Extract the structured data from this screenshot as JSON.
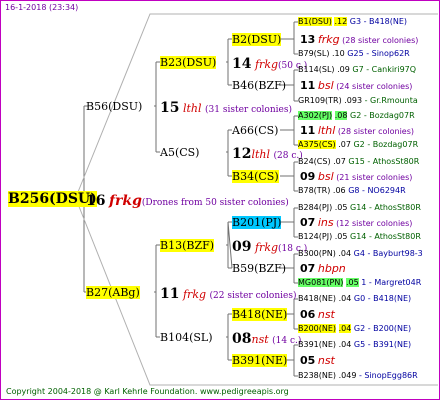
{
  "header": "16-1-2018 (23:34)",
  "footer": "Copyright 2004-2018 @ Karl Kehrle Foundation.   www.pedigreeapis.org",
  "root": {
    "id": "B256(DSU)",
    "num": "16",
    "race": "frkg",
    "note": "(Drones from 50 sister colonies)"
  },
  "gen1": [
    {
      "id": "B56(DSU)",
      "num": "15",
      "race": "lthl",
      "note": "(31 sister colonies)"
    },
    {
      "id": "B27(ABg)",
      "num": "11",
      "race": "frkg",
      "note": "(22 sister colonies)"
    }
  ],
  "gen2": [
    {
      "id": "B23(DSU)",
      "num": "14",
      "race": "frkg",
      "note": "(50 c.)"
    },
    {
      "id": "A5(CS)",
      "num": "12",
      "race": "lthl",
      "note": "(28 c.)"
    },
    {
      "id": "B13(BZF)",
      "num": "09",
      "race": "frkg",
      "note": "(18 c.)"
    },
    {
      "id": "B104(SL)",
      "num": "08",
      "race": "nst",
      "note": "(14 c.)"
    }
  ],
  "gen3": [
    {
      "id": "B2(DSU)",
      "num": "13",
      "race": "frkg",
      "note": "(28 sister colonies)"
    },
    {
      "id": "B46(BZF)",
      "num": "11",
      "race": "bsl",
      "note": "(24 sister colonies)"
    },
    {
      "id": "A66(CS)",
      "num": "11",
      "race": "lthl",
      "note": "(28 sister colonies)"
    },
    {
      "id": "B34(CS)",
      "num": "09",
      "race": "bsl",
      "note": "(21 sister colonies)"
    },
    {
      "id": "B201(PJ)",
      "num": "07",
      "race": "ins",
      "note": "(12 sister colonies)"
    },
    {
      "id": "B59(BZF)",
      "num": "07",
      "race": "hbpn",
      "note": ""
    },
    {
      "id": "B418(NE)",
      "num": "06",
      "race": "nst",
      "note": ""
    },
    {
      "id": "B391(NE)",
      "num": "05",
      "race": "nst",
      "note": ""
    }
  ],
  "gen4": [
    {
      "id": "B1(DSU)",
      "val": ".12",
      "ref": "G3 - B418(NE)"
    },
    {
      "id": "B79(SL)",
      "val": ".10",
      "ref": "G25 - Sinop62R"
    },
    {
      "id": "B114(SL)",
      "val": ".09",
      "ref": "G7 - Cankiri97Q"
    },
    {
      "id": "GR109(TR)",
      "val": ".093",
      "ref": "- Gr.Rmounta"
    },
    {
      "id": "A302(PJ)",
      "val": ".08",
      "ref": "G2 - Bozdag07R"
    },
    {
      "id": "A375(CS)",
      "val": ".07",
      "ref": "G2 - Bozdag07R"
    },
    {
      "id": "B24(CS)",
      "val": ".07",
      "ref": "G15 - AthosSt80R"
    },
    {
      "id": "B78(TR)",
      "val": ".06",
      "ref": "G8 - NO6294R"
    },
    {
      "id": "B284(PJ)",
      "val": ".05",
      "ref": "G14 - AthosSt80R"
    },
    {
      "id": "B124(PJ)",
      "val": ".05",
      "ref": "G14 - AthosSt80R"
    },
    {
      "id": "B300(PN)",
      "val": ".04",
      "ref": "G4 - Bayburt98-3"
    },
    {
      "id": "MG081(PN)",
      "val": ".05",
      "ref": "1 - Margret04R"
    },
    {
      "id": "B418(NE)",
      "val": ".04",
      "ref": "G0 - B418(NE)"
    },
    {
      "id": "B200(NE)",
      "val": ".04",
      "ref": "G2 - B200(NE)"
    },
    {
      "id": "B391(NE)",
      "val": ".04",
      "ref": "G5 - B391(NE)"
    },
    {
      "id": "B238(NE)",
      "val": ".049",
      "ref": "- SinopEgg86R"
    }
  ],
  "colors": {
    "frame": "#c000c0",
    "lines": "#707070",
    "highlight": "#ffff00",
    "cyan": "#00c8ff",
    "green": "#66ff66"
  }
}
